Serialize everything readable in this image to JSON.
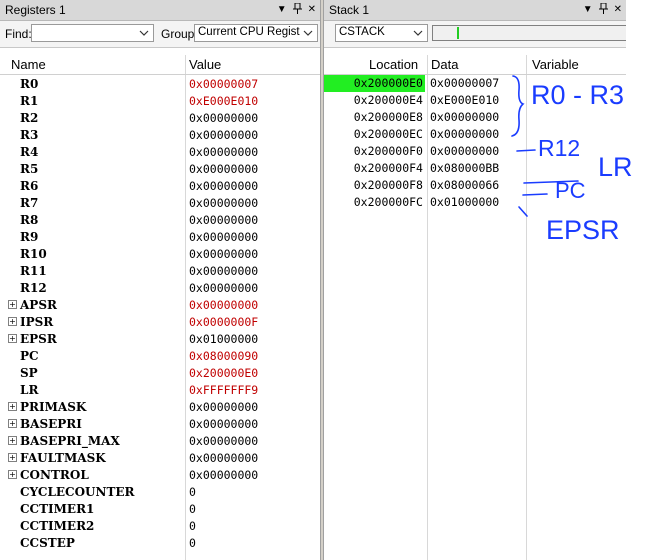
{
  "registers": {
    "title": "Registers 1",
    "find_label": "Find:",
    "find_value": "",
    "group_label": "Group:",
    "group_value": "Current CPU Registe",
    "col_name": "Name",
    "col_value": "Value",
    "rows": [
      {
        "name": "R0",
        "value": "0x00000007",
        "changed": true,
        "expandable": false
      },
      {
        "name": "R1",
        "value": "0xE000E010",
        "changed": true,
        "expandable": false
      },
      {
        "name": "R2",
        "value": "0x00000000",
        "changed": false,
        "expandable": false
      },
      {
        "name": "R3",
        "value": "0x00000000",
        "changed": false,
        "expandable": false
      },
      {
        "name": "R4",
        "value": "0x00000000",
        "changed": false,
        "expandable": false
      },
      {
        "name": "R5",
        "value": "0x00000000",
        "changed": false,
        "expandable": false
      },
      {
        "name": "R6",
        "value": "0x00000000",
        "changed": false,
        "expandable": false
      },
      {
        "name": "R7",
        "value": "0x00000000",
        "changed": false,
        "expandable": false
      },
      {
        "name": "R8",
        "value": "0x00000000",
        "changed": false,
        "expandable": false
      },
      {
        "name": "R9",
        "value": "0x00000000",
        "changed": false,
        "expandable": false
      },
      {
        "name": "R10",
        "value": "0x00000000",
        "changed": false,
        "expandable": false
      },
      {
        "name": "R11",
        "value": "0x00000000",
        "changed": false,
        "expandable": false
      },
      {
        "name": "R12",
        "value": "0x00000000",
        "changed": false,
        "expandable": false
      },
      {
        "name": "APSR",
        "value": "0x00000000",
        "changed": true,
        "expandable": true
      },
      {
        "name": "IPSR",
        "value": "0x0000000F",
        "changed": true,
        "expandable": true
      },
      {
        "name": "EPSR",
        "value": "0x01000000",
        "changed": false,
        "expandable": true
      },
      {
        "name": "PC",
        "value": "0x08000090",
        "changed": true,
        "expandable": false
      },
      {
        "name": "SP",
        "value": "0x200000E0",
        "changed": true,
        "expandable": false
      },
      {
        "name": "LR",
        "value": "0xFFFFFFF9",
        "changed": true,
        "expandable": false
      },
      {
        "name": "PRIMASK",
        "value": "0x00000000",
        "changed": false,
        "expandable": true
      },
      {
        "name": "BASEPRI",
        "value": "0x00000000",
        "changed": false,
        "expandable": true
      },
      {
        "name": "BASEPRI_MAX",
        "value": "0x00000000",
        "changed": false,
        "expandable": true
      },
      {
        "name": "FAULTMASK",
        "value": "0x00000000",
        "changed": false,
        "expandable": true
      },
      {
        "name": "CONTROL",
        "value": "0x00000000",
        "changed": false,
        "expandable": true
      },
      {
        "name": "CYCLECOUNTER",
        "value": "0",
        "changed": false,
        "expandable": false
      },
      {
        "name": "CCTIMER1",
        "value": "0",
        "changed": false,
        "expandable": false
      },
      {
        "name": "CCTIMER2",
        "value": "0",
        "changed": false,
        "expandable": false
      },
      {
        "name": "CCSTEP",
        "value": "0",
        "changed": false,
        "expandable": false
      }
    ]
  },
  "stack": {
    "title": "Stack 1",
    "selector_value": "CSTACK",
    "col_location": "Location",
    "col_data": "Data",
    "col_variable": "Variable",
    "rows": [
      {
        "location": "0x200000E0",
        "data": "0x00000007",
        "highlight": true
      },
      {
        "location": "0x200000E4",
        "data": "0xE000E010",
        "highlight": false
      },
      {
        "location": "0x200000E8",
        "data": "0x00000000",
        "highlight": false
      },
      {
        "location": "0x200000EC",
        "data": "0x00000000",
        "highlight": false
      },
      {
        "location": "0x200000F0",
        "data": "0x00000000",
        "highlight": false
      },
      {
        "location": "0x200000F4",
        "data": "0x080000BB",
        "highlight": false
      },
      {
        "location": "0x200000F8",
        "data": "0x08000066",
        "highlight": false
      },
      {
        "location": "0x200000FC",
        "data": "0x01000000",
        "highlight": false
      }
    ]
  },
  "annotations": {
    "r0_r3": "R0 - R3",
    "r12": "R12",
    "lr": "LR",
    "pc": "PC",
    "epsr": "EPSR"
  },
  "colors": {
    "changed_value": "#c00000",
    "highlight": "#22ee22",
    "ink": "#1a3cff"
  },
  "icons": {
    "dropdown": "chevron-down-icon",
    "pin": "pin-icon",
    "close": "close-icon",
    "expand": "plus-box-icon"
  }
}
